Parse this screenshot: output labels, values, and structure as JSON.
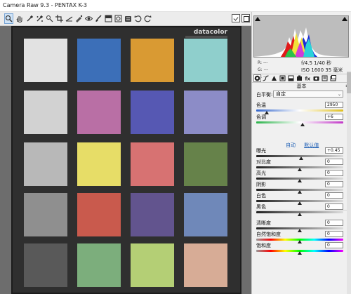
{
  "window": {
    "title": "Camera Raw 9.3 -   PENTAX K-3"
  },
  "toolbar": {
    "tools": [
      {
        "name": "zoom-tool",
        "icon": "zoom-icon"
      },
      {
        "name": "hand-tool",
        "icon": "hand-icon"
      },
      {
        "name": "white-balance-tool",
        "icon": "eyedropper-icon"
      },
      {
        "name": "color-sampler-tool",
        "icon": "color-sampler-icon"
      },
      {
        "name": "targeted-adjustment-tool",
        "icon": "target-adjust-icon"
      },
      {
        "name": "crop-tool",
        "icon": "crop-icon"
      },
      {
        "name": "straighten-tool",
        "icon": "straighten-icon"
      },
      {
        "name": "spot-removal-tool",
        "icon": "spot-removal-icon"
      },
      {
        "name": "red-eye-tool",
        "icon": "red-eye-icon"
      },
      {
        "name": "adjustment-brush-tool",
        "icon": "brush-icon"
      },
      {
        "name": "graduated-filter-tool",
        "icon": "graduated-filter-icon"
      },
      {
        "name": "radial-filter-tool",
        "icon": "radial-filter-icon"
      },
      {
        "name": "preferences-tool",
        "icon": "preferences-icon"
      },
      {
        "name": "rotate-left-tool",
        "icon": "rotate-ccw-icon"
      },
      {
        "name": "rotate-right-tool",
        "icon": "rotate-cw-icon"
      }
    ]
  },
  "image": {
    "brand": "datacolor",
    "patches": [
      "#e2e2e2",
      "#3c6fb8",
      "#d99a33",
      "#8fcfcc",
      "#d2d2d2",
      "#b96fa5",
      "#5658b3",
      "#8c8cc7",
      "#b8b8b8",
      "#e7dd67",
      "#d77272",
      "#66824a",
      "#8f8f8f",
      "#c95a4d",
      "#62548e",
      "#6f88b9",
      "#595959",
      "#7cae7c",
      "#b4cf75",
      "#d7ac96"
    ]
  },
  "histogram": {
    "readout": {
      "r": "R:",
      "g": "G:",
      "b": "B:",
      "dash": "---"
    },
    "camera_line1": "f/4.5   1/40 秒",
    "camera_line2": "ISO 1600   35 毫米"
  },
  "panel": {
    "title": "基本",
    "menu_icon": "≡",
    "white_balance": {
      "label": "白平衡:",
      "value": "自定",
      "arrow": "⌄"
    },
    "auto_link": "自动",
    "default_link": "默认值",
    "controls": {
      "temperature": {
        "label": "色温",
        "value": "2950"
      },
      "tint": {
        "label": "色调",
        "value": "+6"
      },
      "exposure": {
        "label": "曝光",
        "value": "+0.45"
      },
      "contrast": {
        "label": "对比度",
        "value": "0"
      },
      "highlights": {
        "label": "高光",
        "value": "0"
      },
      "shadows": {
        "label": "阴影",
        "value": "0"
      },
      "whites": {
        "label": "白色",
        "value": "0"
      },
      "blacks": {
        "label": "黑色",
        "value": "0"
      },
      "clarity": {
        "label": "清晰度",
        "value": "0"
      },
      "vibrance": {
        "label": "自然饱和度",
        "value": "0"
      },
      "saturation": {
        "label": "饱和度",
        "value": "0"
      }
    }
  }
}
